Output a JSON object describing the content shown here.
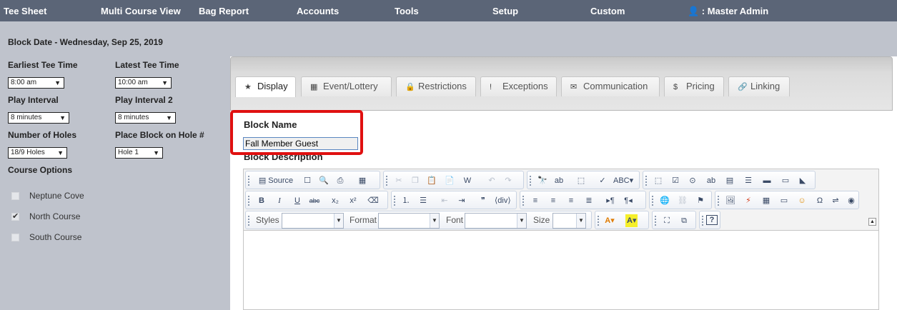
{
  "nav": {
    "items": [
      "Tee Sheet",
      "Multi Course View",
      "Bag Report",
      "Accounts",
      "Tools",
      "Setup",
      "Custom"
    ],
    "user": "👤 : Master Admin"
  },
  "left": {
    "block_date": "Block Date - Wednesday, Sep 25, 2019",
    "earliest_tee_label": "Earliest Tee Time",
    "earliest_tee_value": "8:00 am",
    "latest_tee_label": "Latest Tee Time",
    "latest_tee_value": "10:00 am",
    "play_interval_label": "Play Interval",
    "play_interval_value": "8 minutes",
    "play_interval2_label": "Play Interval 2",
    "play_interval2_value": "8 minutes",
    "holes_label": "Number of Holes",
    "holes_value": "18/9 Holes",
    "place_block_label": "Place Block on Hole #",
    "place_block_value": "Hole 1",
    "course_options_label": "Course Options",
    "courses": [
      {
        "name": "Neptune Cove",
        "checked": false
      },
      {
        "name": "North Course",
        "checked": true
      },
      {
        "name": "South Course",
        "checked": false
      }
    ]
  },
  "tabs": [
    {
      "label": "Display",
      "icon": "star-icon",
      "glyph": "★",
      "active": true
    },
    {
      "label": "Event/Lottery",
      "icon": "calendar-icon",
      "glyph": "▦",
      "active": false
    },
    {
      "label": "Restrictions",
      "icon": "lock-icon",
      "glyph": "🔒",
      "active": false
    },
    {
      "label": "Exceptions",
      "icon": "exclamation-icon",
      "glyph": "!",
      "active": false
    },
    {
      "label": "Communication",
      "icon": "envelope-icon",
      "glyph": "✉",
      "active": false
    },
    {
      "label": "Pricing",
      "icon": "dollar-icon",
      "glyph": "$",
      "active": false
    },
    {
      "label": "Linking",
      "icon": "link-icon",
      "glyph": "🔗",
      "active": false
    }
  ],
  "form": {
    "block_name_label": "Block Name",
    "block_name_value": "Fall Member Guest",
    "block_description_label": "Block Description"
  },
  "editor": {
    "source_label": "Source",
    "styles_label": "Styles",
    "format_label": "Format",
    "font_label": "Font",
    "size_label": "Size"
  }
}
